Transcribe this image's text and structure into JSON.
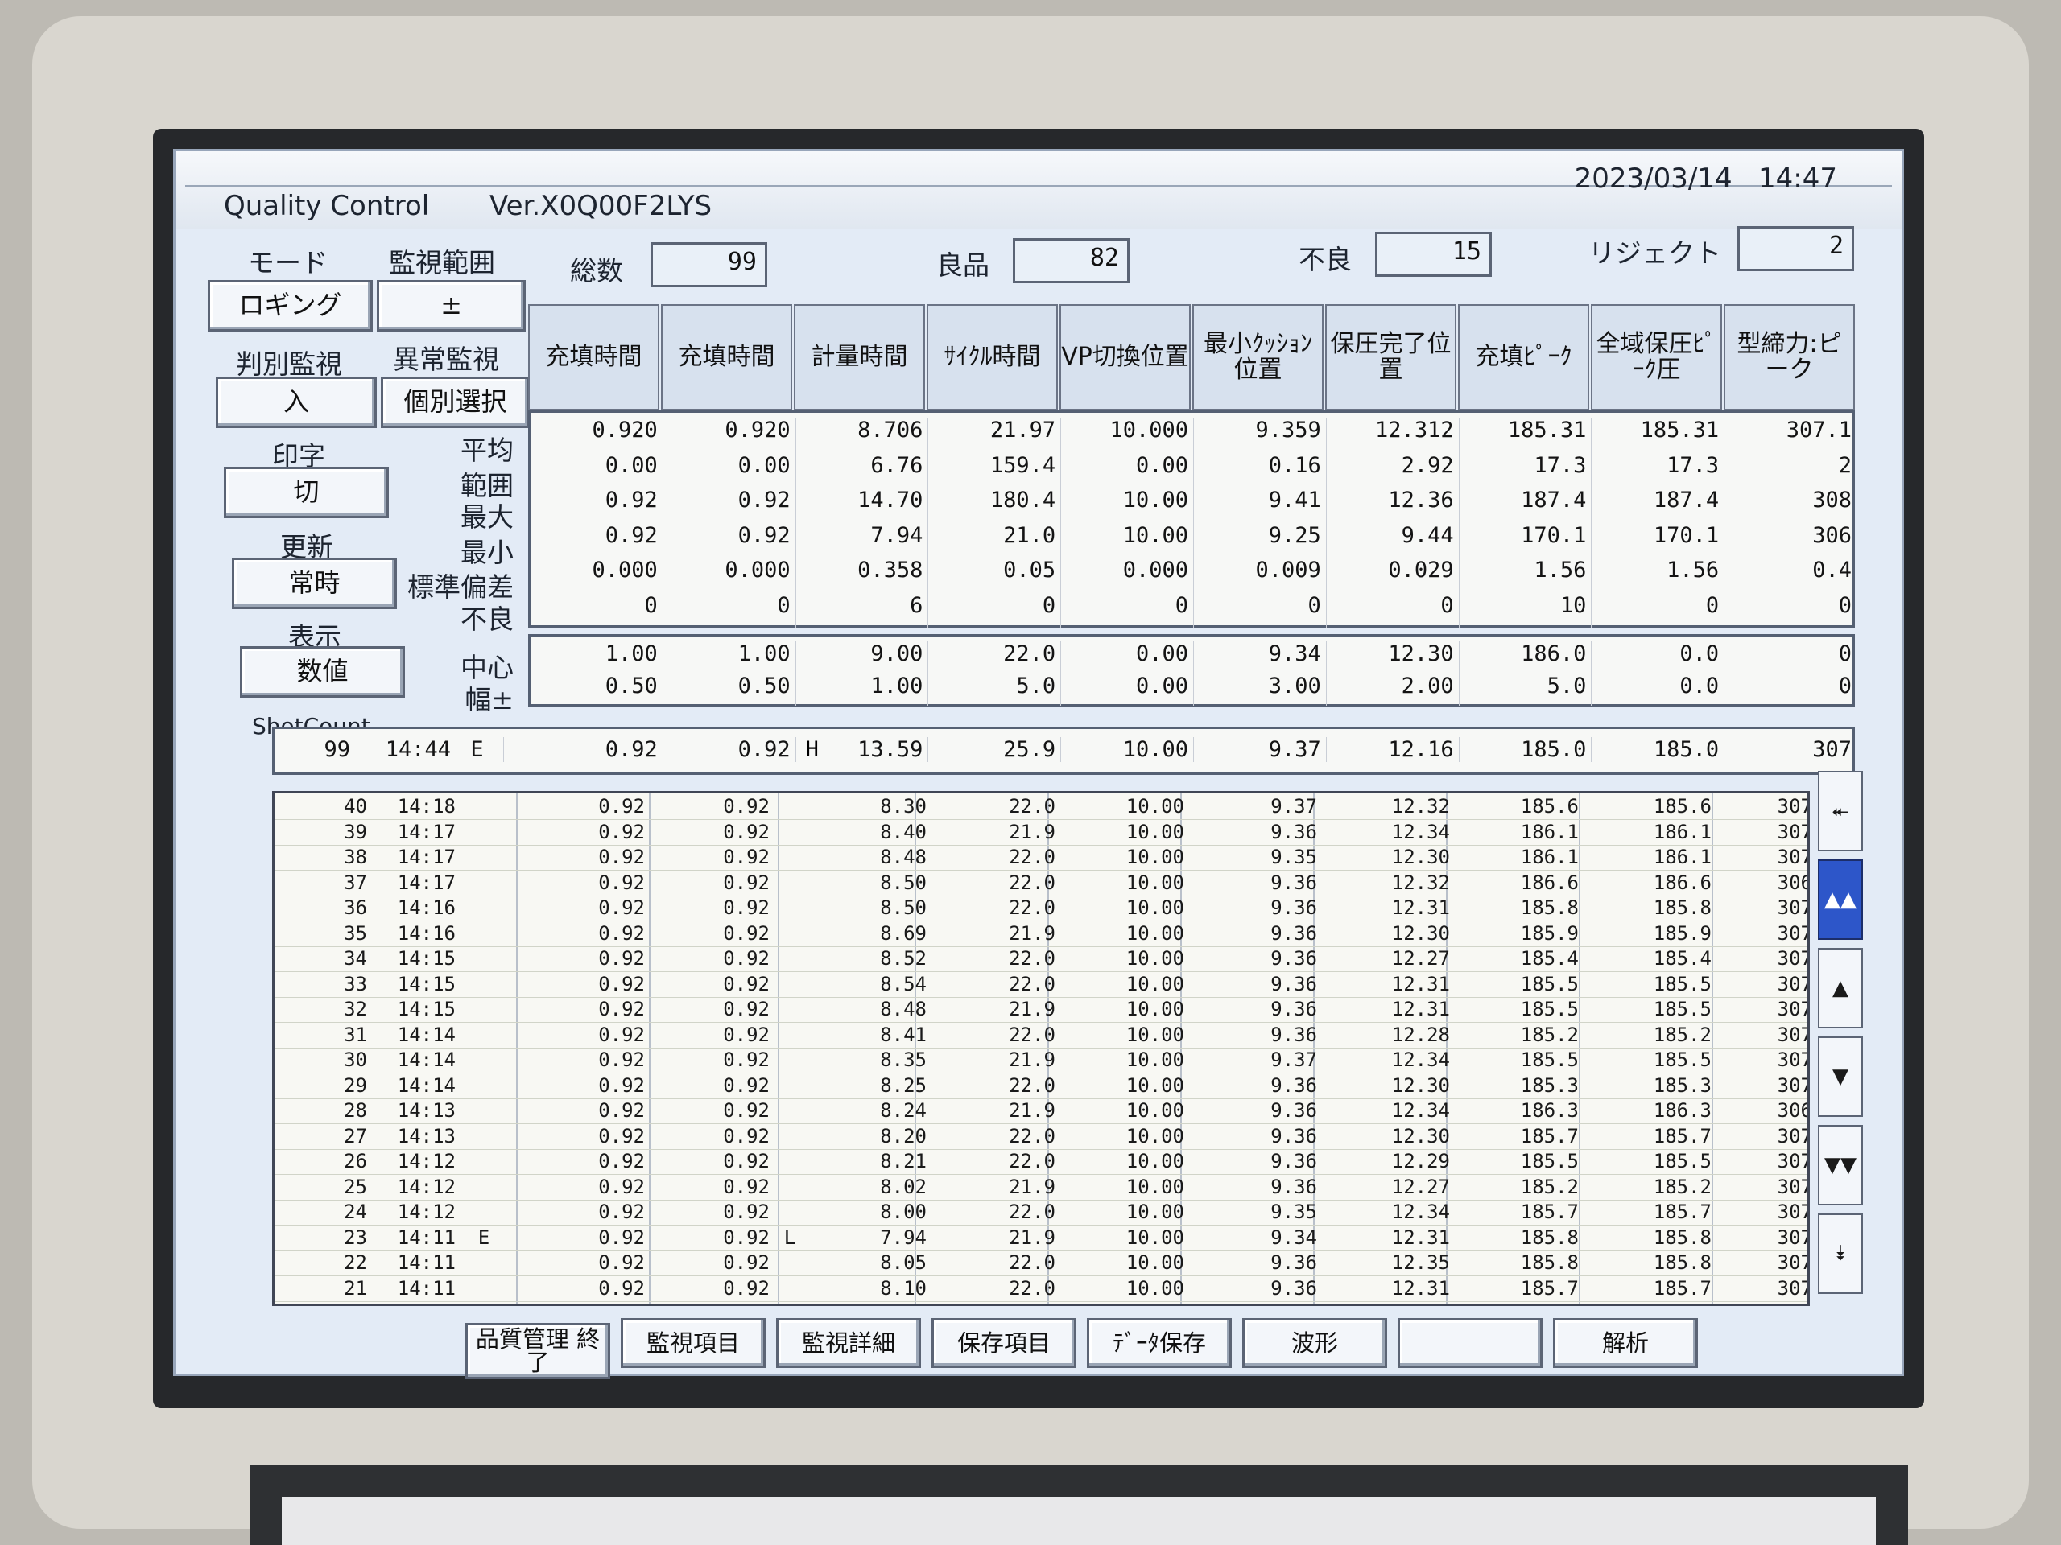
{
  "title": "Quality Control",
  "version": "Ver.X0Q00F2LYS",
  "date": "2023/03/14",
  "time": "14:47",
  "left": {
    "mode_label": "モード",
    "monitor_range_label": "監視範囲",
    "logging_btn": "ロギング",
    "plusminus_btn": "±",
    "judge_label": "判別監視",
    "abnormal_label": "異常監視",
    "on_btn": "入",
    "individual_btn": "個別選択",
    "print_label": "印字",
    "print_btn": "切",
    "update_label": "更新",
    "update_btn": "常時",
    "display_label": "表示",
    "display_btn": "数値",
    "shotcount_label": "ShotCount"
  },
  "counts": {
    "total_label": "総数",
    "total": "99",
    "good_label": "良品",
    "good": "82",
    "bad_label": "不良",
    "bad": "15",
    "reject_label": "リジェクト",
    "reject": "2"
  },
  "row_labels": [
    "平均",
    "範囲",
    "最大",
    "最小",
    "標準偏差",
    "不良"
  ],
  "center_labels": [
    "中心",
    "幅±"
  ],
  "columns": [
    "充填時間",
    "充填時間",
    "計量時間",
    "ｻｲｸﾙ時間",
    "VP切換位置",
    "最小ｸｯｼｮﾝ位置",
    "保圧完了位置",
    "充填ﾋﾟｰｸ",
    "全域保圧ﾋﾟｰｸ圧",
    "型締力:ピーク"
  ],
  "stats": [
    [
      "0.920",
      "0.920",
      "8.706",
      "21.97",
      "10.000",
      "9.359",
      "12.312",
      "185.31",
      "185.31",
      "307.1"
    ],
    [
      "0.00",
      "0.00",
      "6.76",
      "159.4",
      "0.00",
      "0.16",
      "2.92",
      "17.3",
      "17.3",
      "2"
    ],
    [
      "0.92",
      "0.92",
      "14.70",
      "180.4",
      "10.00",
      "9.41",
      "12.36",
      "187.4",
      "187.4",
      "308"
    ],
    [
      "0.92",
      "0.92",
      "7.94",
      "21.0",
      "10.00",
      "9.25",
      "9.44",
      "170.1",
      "170.1",
      "306"
    ],
    [
      "0.000",
      "0.000",
      "0.358",
      "0.05",
      "0.000",
      "0.009",
      "0.029",
      "1.56",
      "1.56",
      "0.4"
    ],
    [
      "0",
      "0",
      "6",
      "0",
      "0",
      "0",
      "0",
      "10",
      "0",
      "0"
    ]
  ],
  "center": [
    [
      "1.00",
      "1.00",
      "9.00",
      "22.0",
      "0.00",
      "9.34",
      "12.30",
      "186.0",
      "0.0",
      "0"
    ],
    [
      "0.50",
      "0.50",
      "1.00",
      "5.0",
      "0.00",
      "3.00",
      "2.00",
      "5.0",
      "0.0",
      "0"
    ]
  ],
  "current": {
    "shot": "99",
    "time": "14:44",
    "flag": "E",
    "values": [
      "0.92",
      "0.92",
      "13.59",
      "25.9",
      "10.00",
      "9.37",
      "12.16",
      "185.0",
      "185.0",
      "307"
    ],
    "marks": [
      "",
      "",
      "H",
      "",
      "",
      "",
      "",
      "",
      "",
      ""
    ]
  },
  "history": [
    [
      "40",
      "14:18",
      "",
      "0.92",
      "0.92",
      "",
      "8.30",
      "22.0",
      "10.00",
      "9.37",
      "12.32",
      "185.6",
      "185.6",
      "307"
    ],
    [
      "39",
      "14:17",
      "",
      "0.92",
      "0.92",
      "",
      "8.40",
      "21.9",
      "10.00",
      "9.36",
      "12.34",
      "186.1",
      "186.1",
      "307"
    ],
    [
      "38",
      "14:17",
      "",
      "0.92",
      "0.92",
      "",
      "8.48",
      "22.0",
      "10.00",
      "9.35",
      "12.30",
      "186.1",
      "186.1",
      "307"
    ],
    [
      "37",
      "14:17",
      "",
      "0.92",
      "0.92",
      "",
      "8.50",
      "22.0",
      "10.00",
      "9.36",
      "12.32",
      "186.6",
      "186.6",
      "306"
    ],
    [
      "36",
      "14:16",
      "",
      "0.92",
      "0.92",
      "",
      "8.50",
      "22.0",
      "10.00",
      "9.36",
      "12.31",
      "185.8",
      "185.8",
      "307"
    ],
    [
      "35",
      "14:16",
      "",
      "0.92",
      "0.92",
      "",
      "8.69",
      "21.9",
      "10.00",
      "9.36",
      "12.30",
      "185.9",
      "185.9",
      "307"
    ],
    [
      "34",
      "14:15",
      "",
      "0.92",
      "0.92",
      "",
      "8.52",
      "22.0",
      "10.00",
      "9.36",
      "12.27",
      "185.4",
      "185.4",
      "307"
    ],
    [
      "33",
      "14:15",
      "",
      "0.92",
      "0.92",
      "",
      "8.54",
      "22.0",
      "10.00",
      "9.36",
      "12.31",
      "185.5",
      "185.5",
      "307"
    ],
    [
      "32",
      "14:15",
      "",
      "0.92",
      "0.92",
      "",
      "8.48",
      "21.9",
      "10.00",
      "9.36",
      "12.31",
      "185.5",
      "185.5",
      "307"
    ],
    [
      "31",
      "14:14",
      "",
      "0.92",
      "0.92",
      "",
      "8.41",
      "22.0",
      "10.00",
      "9.36",
      "12.28",
      "185.2",
      "185.2",
      "307"
    ],
    [
      "30",
      "14:14",
      "",
      "0.92",
      "0.92",
      "",
      "8.35",
      "21.9",
      "10.00",
      "9.37",
      "12.34",
      "185.5",
      "185.5",
      "307"
    ],
    [
      "29",
      "14:14",
      "",
      "0.92",
      "0.92",
      "",
      "8.25",
      "22.0",
      "10.00",
      "9.36",
      "12.30",
      "185.3",
      "185.3",
      "307"
    ],
    [
      "28",
      "14:13",
      "",
      "0.92",
      "0.92",
      "",
      "8.24",
      "21.9",
      "10.00",
      "9.36",
      "12.34",
      "186.3",
      "186.3",
      "306"
    ],
    [
      "27",
      "14:13",
      "",
      "0.92",
      "0.92",
      "",
      "8.20",
      "22.0",
      "10.00",
      "9.36",
      "12.30",
      "185.7",
      "185.7",
      "307"
    ],
    [
      "26",
      "14:12",
      "",
      "0.92",
      "0.92",
      "",
      "8.21",
      "22.0",
      "10.00",
      "9.36",
      "12.29",
      "185.5",
      "185.5",
      "307"
    ],
    [
      "25",
      "14:12",
      "",
      "0.92",
      "0.92",
      "",
      "8.02",
      "21.9",
      "10.00",
      "9.36",
      "12.27",
      "185.2",
      "185.2",
      "307"
    ],
    [
      "24",
      "14:12",
      "",
      "0.92",
      "0.92",
      "",
      "8.00",
      "22.0",
      "10.00",
      "9.35",
      "12.34",
      "185.7",
      "185.7",
      "307"
    ],
    [
      "23",
      "14:11",
      "E",
      "0.92",
      "0.92",
      "L",
      "7.94",
      "21.9",
      "10.00",
      "9.34",
      "12.31",
      "185.8",
      "185.8",
      "307"
    ],
    [
      "22",
      "14:11",
      "",
      "0.92",
      "0.92",
      "",
      "8.05",
      "22.0",
      "10.00",
      "9.36",
      "12.35",
      "185.8",
      "185.8",
      "307"
    ],
    [
      "21",
      "14:11",
      "",
      "0.92",
      "0.92",
      "",
      "8.10",
      "22.0",
      "10.00",
      "9.36",
      "12.31",
      "185.7",
      "185.7",
      "307"
    ]
  ],
  "nav_icons": [
    "double-up-bar-icon",
    "double-up-icon",
    "up-icon",
    "down-icon",
    "double-down-icon",
    "double-down-bar-icon"
  ],
  "footer": [
    "品質管理 終了",
    "監視項目",
    "監視詳細",
    "保存項目",
    "ﾃﾞｰﾀ保存",
    "波形",
    "",
    "解析"
  ]
}
